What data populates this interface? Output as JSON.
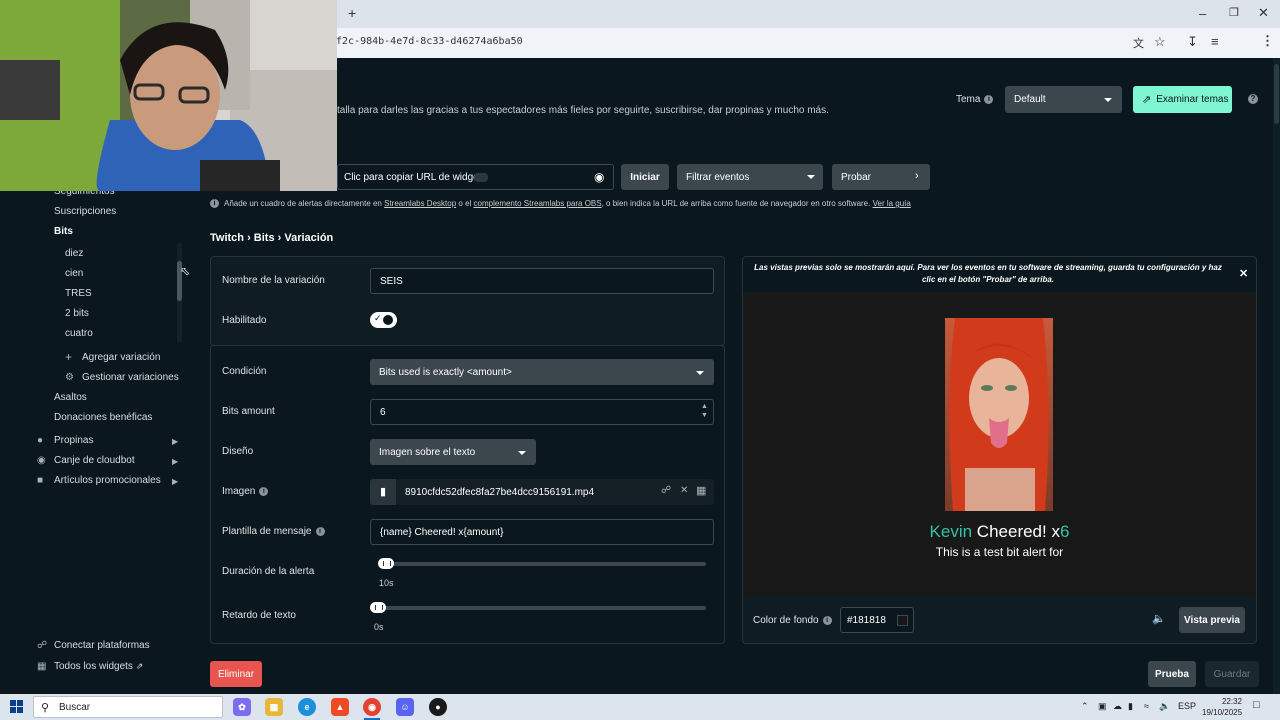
{
  "browser": {
    "url_fragment": "f2c-984b-4e7d-8c33-d46274a6ba50",
    "new_tab_symbol": "+"
  },
  "header": {
    "description": "talla para darles las gracias a tus espectadores más fieles por seguirte, suscribirse, dar propinas y mucho más.",
    "theme_label": "Tema",
    "theme_value": "Default",
    "examine_themes": "Examinar temas",
    "help_symbol": "?"
  },
  "url_bar": {
    "copy_url_label": "Clic para copiar URL de widget",
    "start_button": "Iniciar",
    "filter_events": "Filtrar eventos",
    "test_button": "Probar"
  },
  "notice": {
    "prefix": "Añade un cuadro de alertas directamente en",
    "link1": "Streamlabs Desktop",
    "middle1": "o el",
    "link2": "complemento Streamlabs para OBS",
    "middle2": ", o bien indica la URL de arriba como fuente de navegador en otro software.",
    "link3": "Ver la guía"
  },
  "breadcrumb": "Twitch › Bits › Variación",
  "sidebar": {
    "partial_top": "Seguimientos",
    "subscriptions": "Suscripciones",
    "bits": "Bits",
    "variations": [
      "diez",
      "cien",
      "TRES",
      "2 bits",
      "cuatro"
    ],
    "add_variation": "Agregar variación",
    "manage_variations": "Gestionar variaciones",
    "raids": "Asaltos",
    "charity": "Donaciones benéficas",
    "tips": "Propinas",
    "cloudbot": "Canje de cloudbot",
    "merch": "Artículos promocionales",
    "connect_platforms": "Conectar plataformas",
    "all_widgets": "Todos los widgets"
  },
  "form": {
    "variation_name_label": "Nombre de la variación",
    "variation_name_value": "SEIS",
    "enabled_label": "Habilitado",
    "condition_label": "Condición",
    "condition_value": "Bits used is exactly <amount>",
    "bits_amount_label": "Bits amount",
    "bits_amount_value": "6",
    "design_label": "Diseño",
    "design_value": "Imagen sobre el texto",
    "image_label": "Imagen",
    "image_value": "8910cfdc52dfec8fa27be4dcc9156191.mp4",
    "message_template_label": "Plantilla de mensaje",
    "message_template_value": "{name} Cheered! x{amount}",
    "alert_duration_label": "Duración de la alerta",
    "alert_duration_value": "10s",
    "alert_duration_fraction": 0.0,
    "text_delay_label": "Retardo de texto",
    "text_delay_value": "0s",
    "text_delay_fraction": 0.0
  },
  "preview": {
    "notice": "Las vistas previas solo se mostrarán aquí. Para ver los eventos en tu software de streaming, guarda tu configuración y haz clic en el botón \"Probar\" de arriba.",
    "close_symbol": "✕",
    "alert_name": "Kevin",
    "alert_middle": " Cheered! x",
    "alert_amount": "6",
    "alert_message": "This is a test bit alert for",
    "bg_color_label": "Color de fondo",
    "bg_color_value": "#181818",
    "preview_button": "Vista previa"
  },
  "footer": {
    "delete_button": "Eliminar",
    "test_button": "Prueba",
    "save_button": "Guardar"
  },
  "taskbar": {
    "search_placeholder": "Buscar",
    "language": "ESP",
    "time": "22:32",
    "date": "19/10/2025"
  },
  "colors": {
    "accent": "#80f5d2",
    "danger": "#e85450",
    "name_highlight": "#32c3a6",
    "preview_bg": "#181818"
  }
}
